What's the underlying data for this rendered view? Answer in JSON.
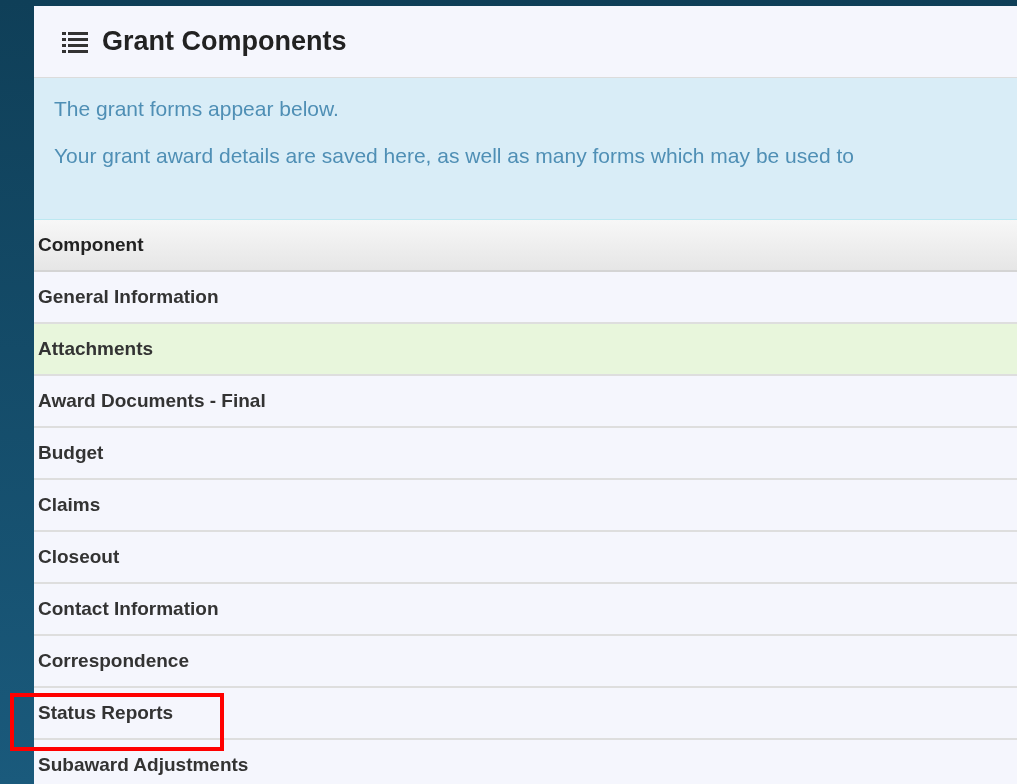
{
  "panel": {
    "title": "Grant Components"
  },
  "info": {
    "lines": [
      "The grant forms appear below.",
      "Your grant award details are saved here, as well as many forms which may be used to"
    ]
  },
  "table": {
    "columns": [
      "Component"
    ],
    "rows": [
      {
        "name": "General Information",
        "highlighted": false,
        "annotated": false
      },
      {
        "name": "Attachments",
        "highlighted": true,
        "annotated": false
      },
      {
        "name": "Award Documents - Final",
        "highlighted": false,
        "annotated": false
      },
      {
        "name": "Budget",
        "highlighted": false,
        "annotated": false
      },
      {
        "name": "Claims",
        "highlighted": false,
        "annotated": false
      },
      {
        "name": "Closeout",
        "highlighted": false,
        "annotated": false
      },
      {
        "name": "Contact Information",
        "highlighted": false,
        "annotated": false
      },
      {
        "name": "Correspondence",
        "highlighted": false,
        "annotated": false
      },
      {
        "name": "Status Reports",
        "highlighted": false,
        "annotated": true
      },
      {
        "name": "Subaward Adjustments",
        "highlighted": false,
        "annotated": false
      }
    ]
  }
}
